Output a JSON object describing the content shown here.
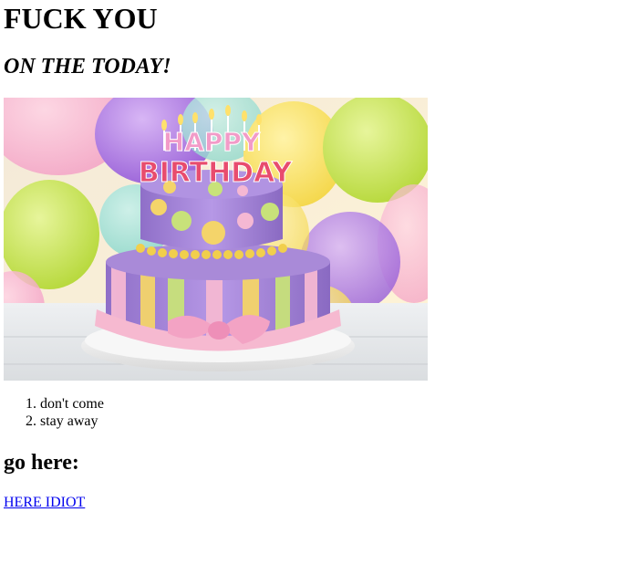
{
  "page": {
    "heading": "FUCK YOU",
    "subheading": "ON THE TODAY!"
  },
  "image": {
    "alt": "birthday cake",
    "cake_text_top": "HAPPY",
    "cake_text_bottom": "BIRTHDAY"
  },
  "list": {
    "items": [
      "don't come",
      "stay away"
    ]
  },
  "section": {
    "heading": "go here:"
  },
  "link": {
    "label": "HERE IDIOT"
  },
  "colors": {
    "link": "#0000ee",
    "text": "#000000",
    "background": "#ffffff"
  }
}
